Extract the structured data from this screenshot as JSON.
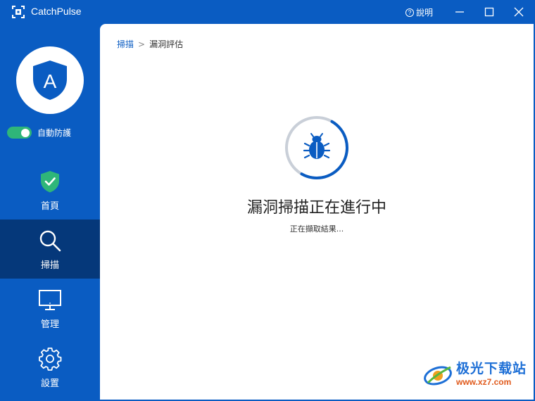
{
  "window": {
    "title": "CatchPulse",
    "help_label": "說明",
    "help_icon_glyph": "?"
  },
  "sidebar": {
    "avatar_letter": "A",
    "auto_protect_label": "自動防護",
    "auto_protect_on": true,
    "items": [
      {
        "label": "首頁",
        "icon": "shield-check-icon",
        "active": false
      },
      {
        "label": "掃描",
        "icon": "magnifier-icon",
        "active": true
      },
      {
        "label": "管理",
        "icon": "monitor-icon",
        "active": false
      },
      {
        "label": "設置",
        "icon": "gear-icon",
        "active": false
      }
    ]
  },
  "breadcrumb": {
    "parent": "掃描",
    "separator": ">",
    "current": "漏洞評估"
  },
  "scan": {
    "title": "漏洞掃描正在進行中",
    "status": "正在擷取結果...",
    "icon": "bug-icon"
  },
  "watermark": {
    "name": "极光下载站",
    "url": "www.xz7.com"
  },
  "colors": {
    "brand_blue": "#0a5cc2",
    "active_nav": "#05387a",
    "toggle_green": "#2fb679"
  }
}
